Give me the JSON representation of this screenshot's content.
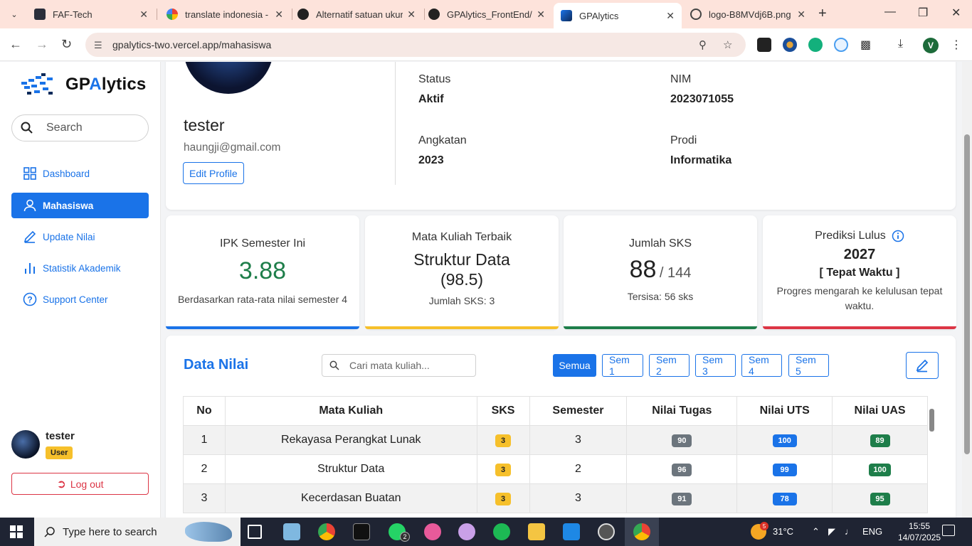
{
  "browser": {
    "tabs": [
      {
        "title": "FAF-Tech",
        "favicon": "faf-favicon"
      },
      {
        "title": "translate indonesia - G",
        "favicon": "google-favicon"
      },
      {
        "title": "Alternatif satuan ukur",
        "favicon": "chatgpt-favicon"
      },
      {
        "title": "GPAlytics_FrontEnd/P",
        "favicon": "github-favicon"
      },
      {
        "title": "GPAlytics",
        "favicon": "gpalytics-favicon"
      },
      {
        "title": "logo-B8MVdj6B.png (",
        "favicon": "globe-favicon"
      }
    ],
    "url": "gpalytics-two.vercel.app/mahasiswa",
    "profile_initial": "V"
  },
  "app": {
    "logo_text_prefix": "GP",
    "logo_text_accent": "A",
    "logo_text_suffix": "lytics",
    "search_placeholder": "Search",
    "nav": [
      {
        "label": "Dashboard",
        "icon": "dashboard-icon"
      },
      {
        "label": "Mahasiswa",
        "icon": "user-icon"
      },
      {
        "label": "Update Nilai",
        "icon": "pencil-icon"
      },
      {
        "label": "Statistik Akademik",
        "icon": "bar-chart-icon"
      },
      {
        "label": "Support Center",
        "icon": "help-icon"
      }
    ],
    "user": {
      "name": "tester",
      "role": "User"
    },
    "logout_label": "Log out"
  },
  "profile": {
    "name": "tester",
    "email": "haungji@gmail.com",
    "edit_label": "Edit Profile",
    "fields": {
      "status_label": "Status",
      "status_value": "Aktif",
      "nim_label": "NIM",
      "nim_value": "2023071055",
      "angkatan_label": "Angkatan",
      "angkatan_value": "2023",
      "prodi_label": "Prodi",
      "prodi_value": "Informatika"
    }
  },
  "stats": {
    "ipk": {
      "title": "IPK Semester Ini",
      "value": "3.88",
      "sub": "Berdasarkan rata-rata nilai semester 4",
      "color": "#1a73e8"
    },
    "best": {
      "title": "Mata Kuliah Terbaik",
      "name": "Struktur Data",
      "score": "(98.5)",
      "sub": "Jumlah SKS: 3",
      "color": "#f6c02b"
    },
    "sks": {
      "title": "Jumlah SKS",
      "value": "88",
      "total": "/ 144",
      "sub": "Tersisa: 56 sks",
      "color": "#1e7e4a"
    },
    "lulus": {
      "title": "Prediksi Lulus",
      "year": "2027",
      "status": "[ Tepat Waktu ]",
      "sub": "Progres mengarah ke kelulusan tepat waktu.",
      "color": "#dc3545"
    }
  },
  "grades": {
    "title": "Data Nilai",
    "search_placeholder": "Cari mata kuliah...",
    "filters": [
      "Semua",
      "Sem 1",
      "Sem 2",
      "Sem 3",
      "Sem 4",
      "Sem 5"
    ],
    "columns": [
      "No",
      "Mata Kuliah",
      "SKS",
      "Semester",
      "Nilai Tugas",
      "Nilai UTS",
      "Nilai UAS"
    ],
    "rows": [
      {
        "no": "1",
        "course": "Rekayasa Perangkat Lunak",
        "sks": "3",
        "semester": "3",
        "tugas": "90",
        "uts": "100",
        "uas": "89"
      },
      {
        "no": "2",
        "course": "Struktur Data",
        "sks": "3",
        "semester": "2",
        "tugas": "96",
        "uts": "99",
        "uas": "100"
      },
      {
        "no": "3",
        "course": "Kecerdasan Buatan",
        "sks": "3",
        "semester": "3",
        "tugas": "91",
        "uts": "78",
        "uas": "95"
      }
    ]
  },
  "taskbar": {
    "search_placeholder": "Type here to search",
    "weather": "31°C",
    "lang": "ENG",
    "time": "15:55",
    "date": "14/07/2025",
    "whatsapp_badge": "2",
    "weather_badge": "5"
  }
}
